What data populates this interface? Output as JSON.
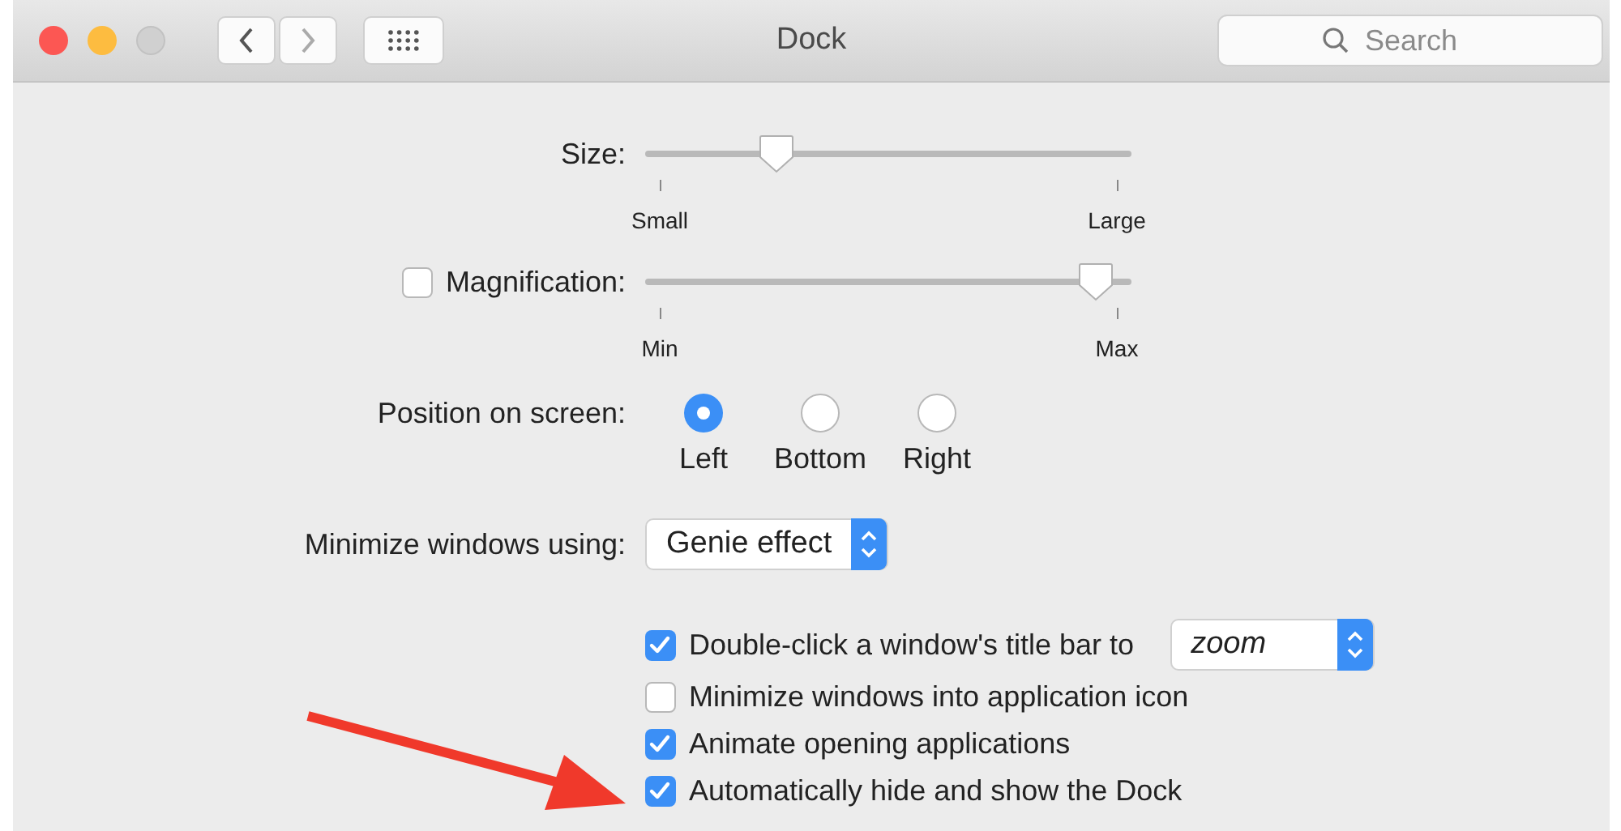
{
  "window": {
    "title": "Dock"
  },
  "toolbar": {
    "search": {
      "placeholder": "Search"
    }
  },
  "size": {
    "label": "Size:",
    "level": 0.25,
    "min_label": "Small",
    "max_label": "Large"
  },
  "magnification": {
    "label": "Magnification:",
    "checked": false,
    "level": 0.96,
    "min_label": "Min",
    "max_label": "Max"
  },
  "position": {
    "label": "Position on screen:",
    "options": [
      {
        "label": "Left",
        "selected": true
      },
      {
        "label": "Bottom",
        "selected": false
      },
      {
        "label": "Right",
        "selected": false
      }
    ]
  },
  "minimize": {
    "label": "Minimize windows using:",
    "value": "Genie effect"
  },
  "options": [
    {
      "kind": "checkbox-popup",
      "label": "Double-click a window's title bar to",
      "checked": true,
      "value": "zoom"
    },
    {
      "kind": "checkbox",
      "label": "Minimize windows into application icon",
      "checked": false
    },
    {
      "kind": "checkbox",
      "label": "Animate opening applications",
      "checked": true
    },
    {
      "kind": "checkbox",
      "label": "Automatically hide and show the Dock",
      "checked": true
    }
  ]
}
